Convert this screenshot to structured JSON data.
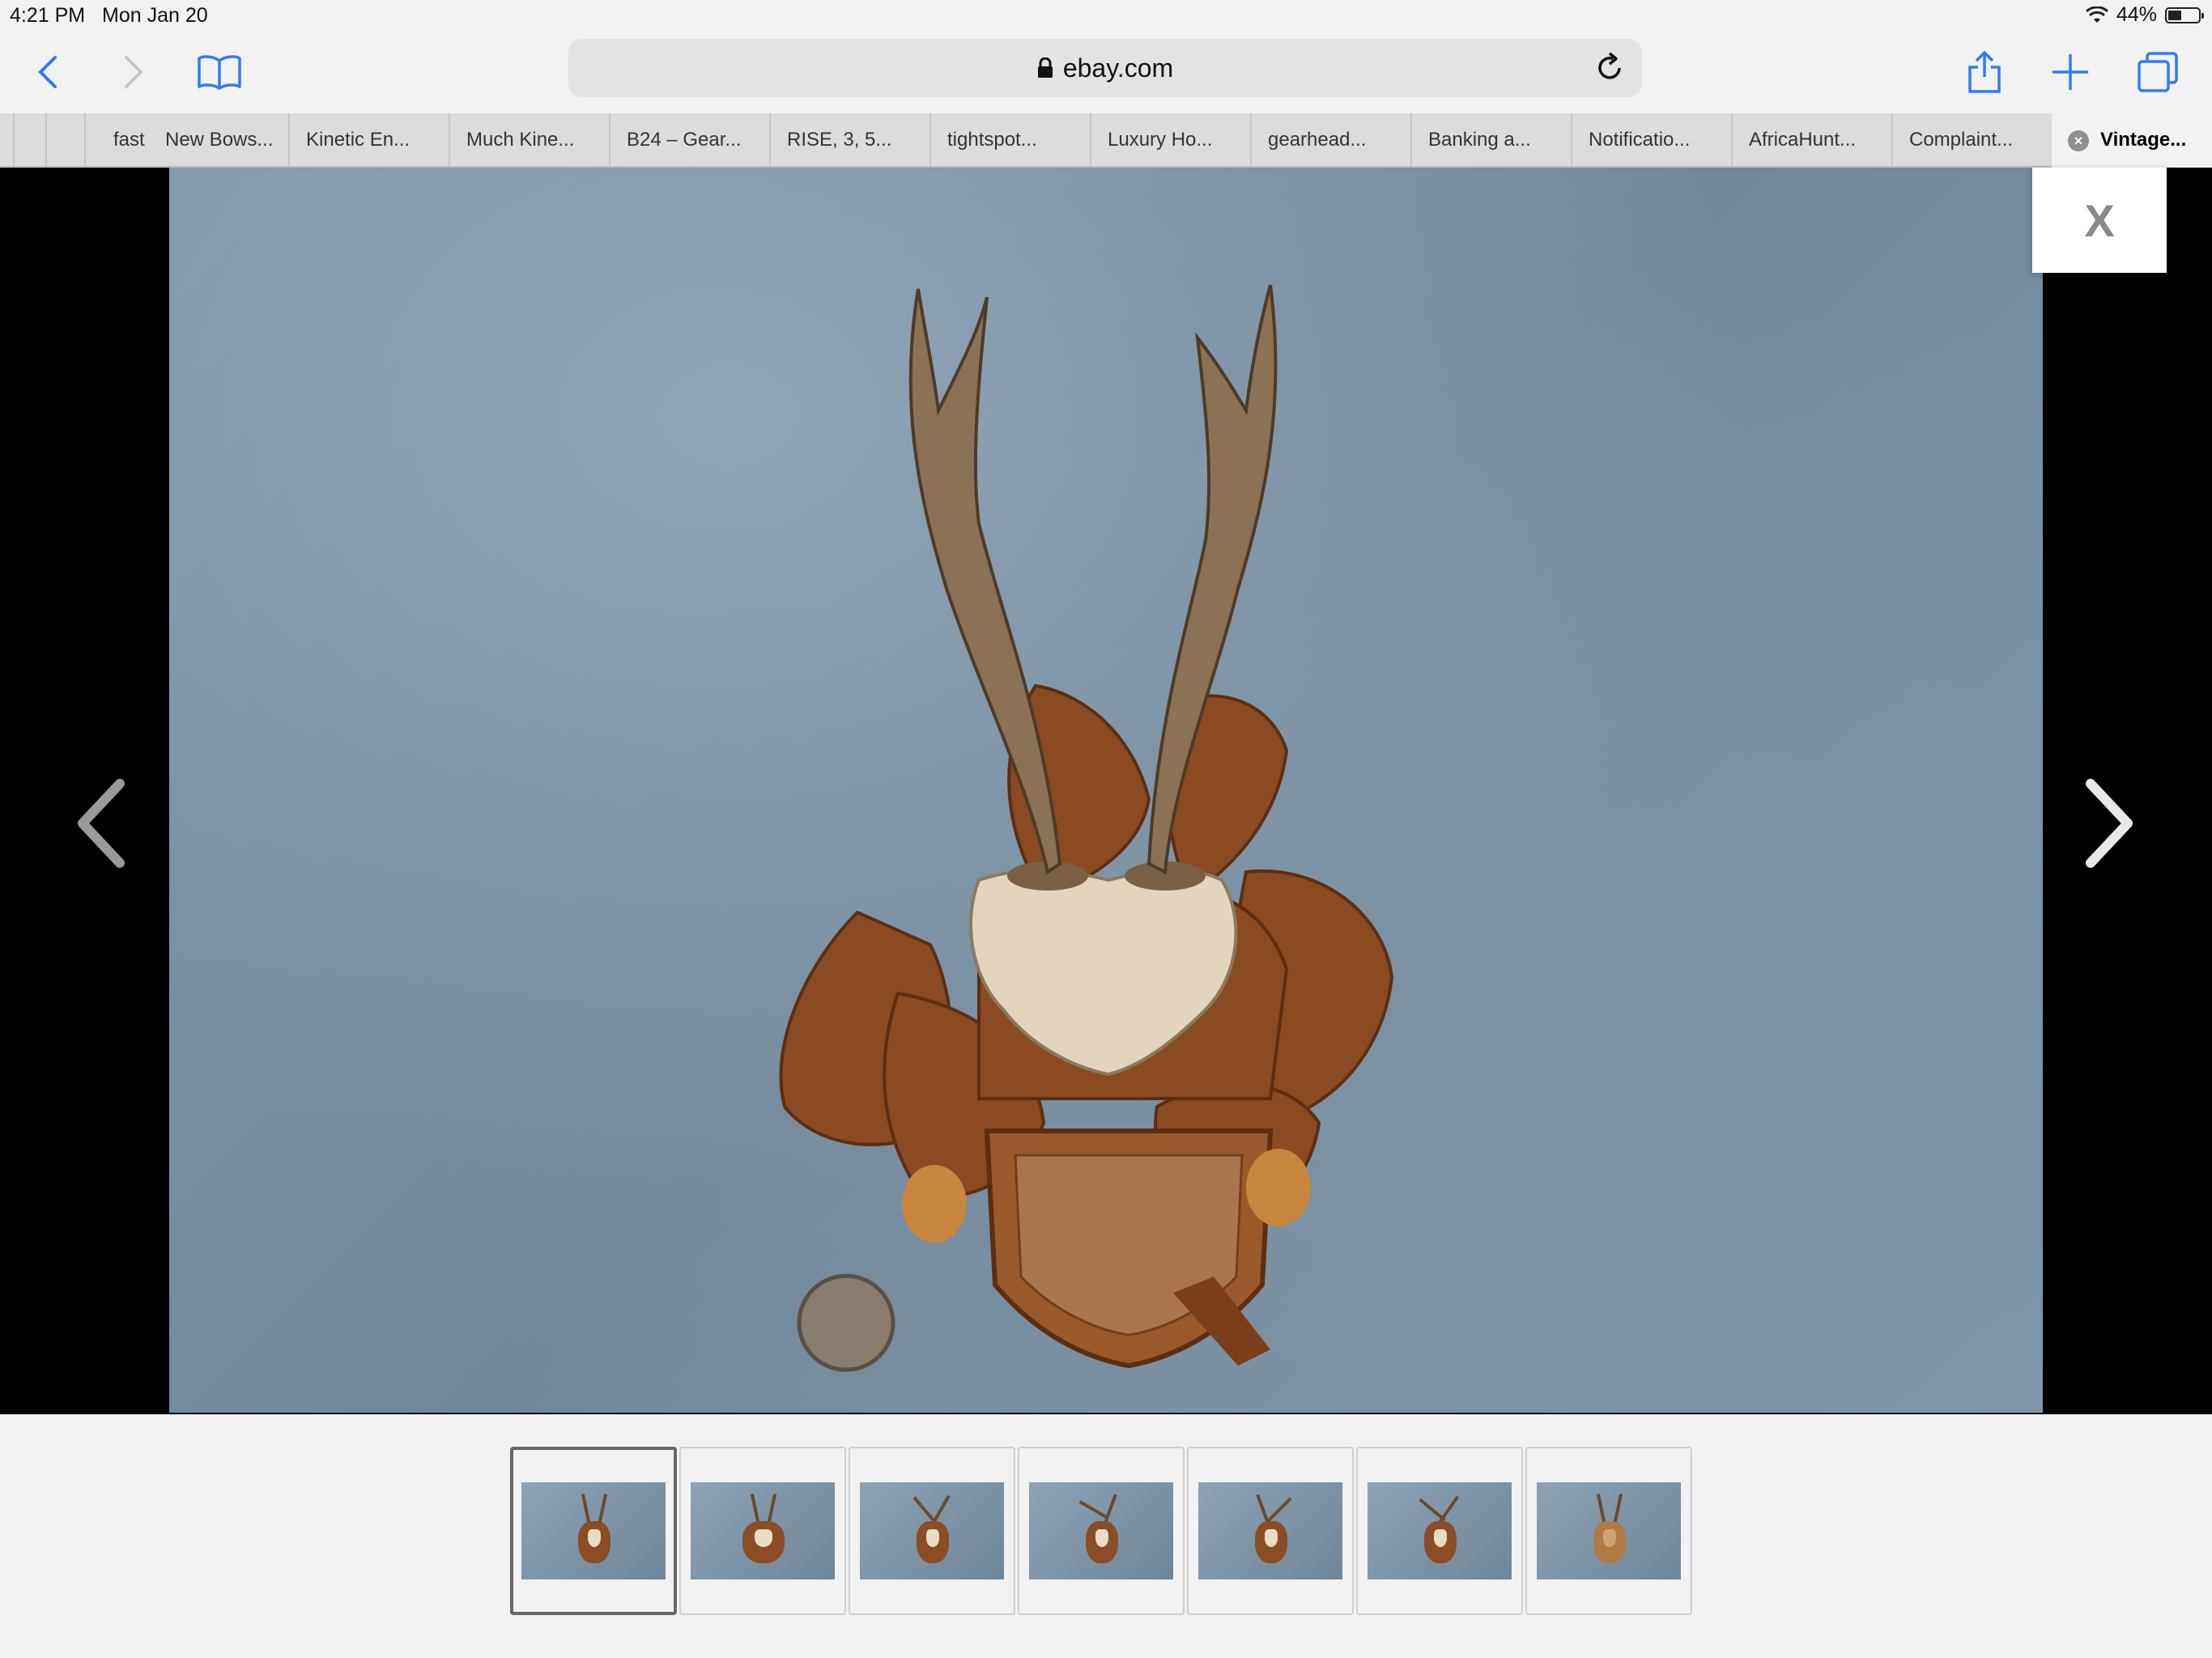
{
  "status_bar": {
    "time": "4:21 PM",
    "date": "Mon Jan 20",
    "battery": "44%",
    "battery_level": 0.44
  },
  "toolbar": {
    "url": "ebay.com"
  },
  "tabs": [
    {
      "label": ""
    },
    {
      "label": ""
    },
    {
      "label": "fast"
    },
    {
      "label": "New Bows..."
    },
    {
      "label": "Kinetic En..."
    },
    {
      "label": "Much Kine..."
    },
    {
      "label": "B24 – Gear..."
    },
    {
      "label": "RISE, 3, 5..."
    },
    {
      "label": "tightspot..."
    },
    {
      "label": "Luxury Ho..."
    },
    {
      "label": "gearhead..."
    },
    {
      "label": "Banking a..."
    },
    {
      "label": "Notificatio..."
    },
    {
      "label": "AfricaHunt..."
    },
    {
      "label": "Complaint..."
    },
    {
      "label": "Vintage..."
    }
  ],
  "viewer": {
    "close_label": "X",
    "thumbnail_count": 7,
    "selected_index": 0
  },
  "colors": {
    "accent": "#2f7cf6",
    "viewer_bg": "#000000",
    "photo_bg": "#7d93a6"
  }
}
